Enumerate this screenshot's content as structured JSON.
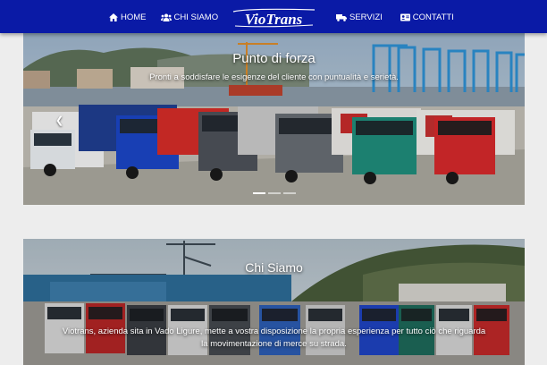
{
  "navbar": {
    "items_left": [
      {
        "label": "HOME",
        "icon": "home-icon"
      },
      {
        "label": "CHI SIAMO",
        "icon": "users-icon"
      }
    ],
    "logo_text": "VioTrans",
    "items_right": [
      {
        "label": "SERVIZI",
        "icon": "truck-icon"
      },
      {
        "label": "CONTATTI",
        "icon": "contact-card-icon"
      }
    ],
    "colors": {
      "background": "#0a1aa6",
      "text": "#ffffff"
    }
  },
  "slider": {
    "title": "Punto di forza",
    "text": "Pronti a soddisfare le esigenze del cliente con puntualità e serietà.",
    "indicators": 3,
    "active_index": 0,
    "prev_icon": "chevron-left-icon"
  },
  "about": {
    "title": "Chi Siamo",
    "text": "Viotrans, azienda sita in Vado Ligure, mette a vostra disposizione la propria esperienza per tutto ciò che riguarda la movimentazione di merce su strada."
  }
}
